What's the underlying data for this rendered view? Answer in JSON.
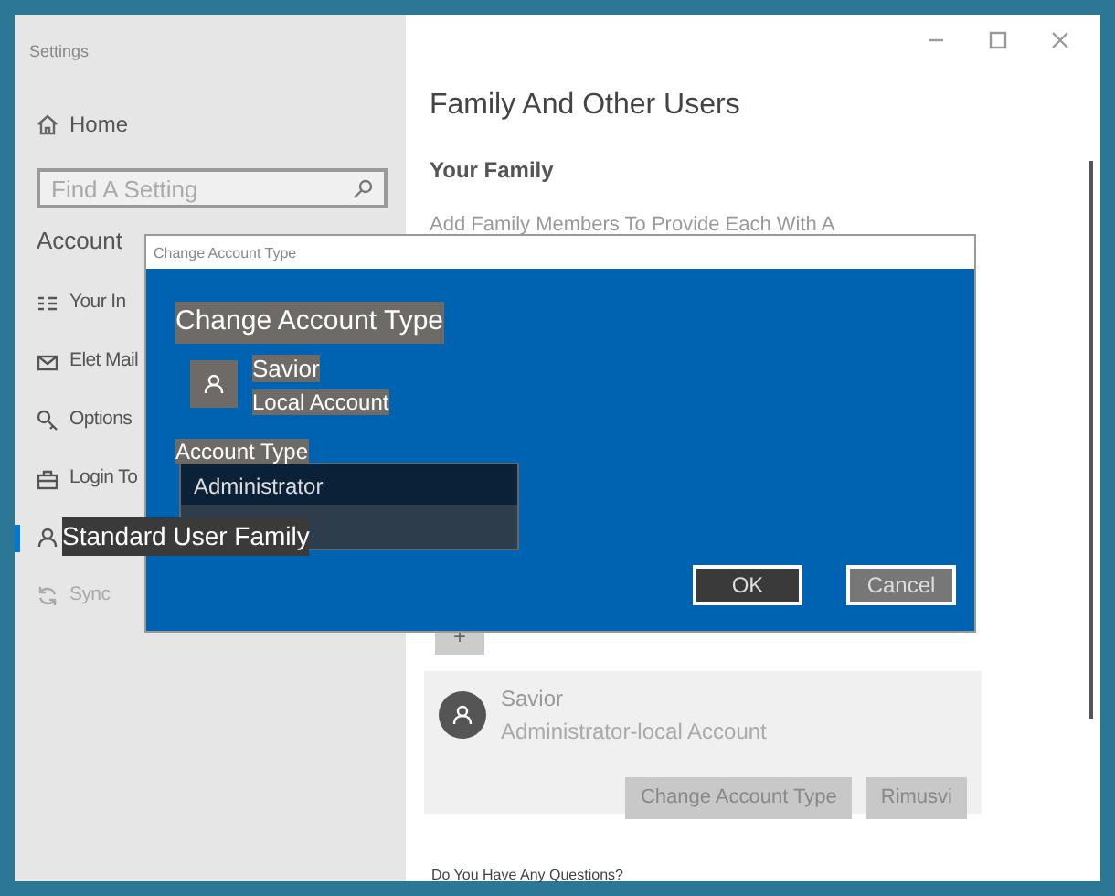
{
  "window": {
    "title": "Settings"
  },
  "sidebar": {
    "home": "Home",
    "search": {
      "placeholder": "Find A Setting"
    },
    "section": "Account",
    "items": [
      {
        "label": "Your In",
        "kind": "info",
        "selected": false,
        "disabled": false
      },
      {
        "label": "Elet Mail",
        "kind": "mail",
        "selected": false,
        "disabled": false
      },
      {
        "label": "Options",
        "kind": "key",
        "selected": false,
        "disabled": false
      },
      {
        "label": "Login To",
        "kind": "briefcase",
        "selected": false,
        "disabled": false
      },
      {
        "label": "Standard User Family",
        "kind": "person",
        "selected": true,
        "disabled": false
      },
      {
        "label": "Sync",
        "kind": "sync",
        "selected": false,
        "disabled": true
      }
    ]
  },
  "content": {
    "heading": "Family And Other Users",
    "subheading": "Your Family",
    "description": "Add Family Members To Provide Each With A",
    "add_button": "+",
    "user_card": {
      "name": "Savior",
      "account": "Administrator-local Account",
      "buttons": [
        "Change Account Type",
        "Rimusvi"
      ]
    },
    "footer_link": "Do You Have Any Questions?"
  },
  "dialog": {
    "title": "Change Account Type",
    "heading": "Change Account Type",
    "user": {
      "name": "Savior",
      "account": "Local Account"
    },
    "field_label": "Account Type",
    "dropdown": {
      "options": [
        {
          "label": "Administrator",
          "selected": true
        }
      ]
    },
    "buttons": [
      {
        "label": "OK",
        "primary": true
      },
      {
        "label": "Cancel",
        "primary": false
      }
    ]
  }
}
